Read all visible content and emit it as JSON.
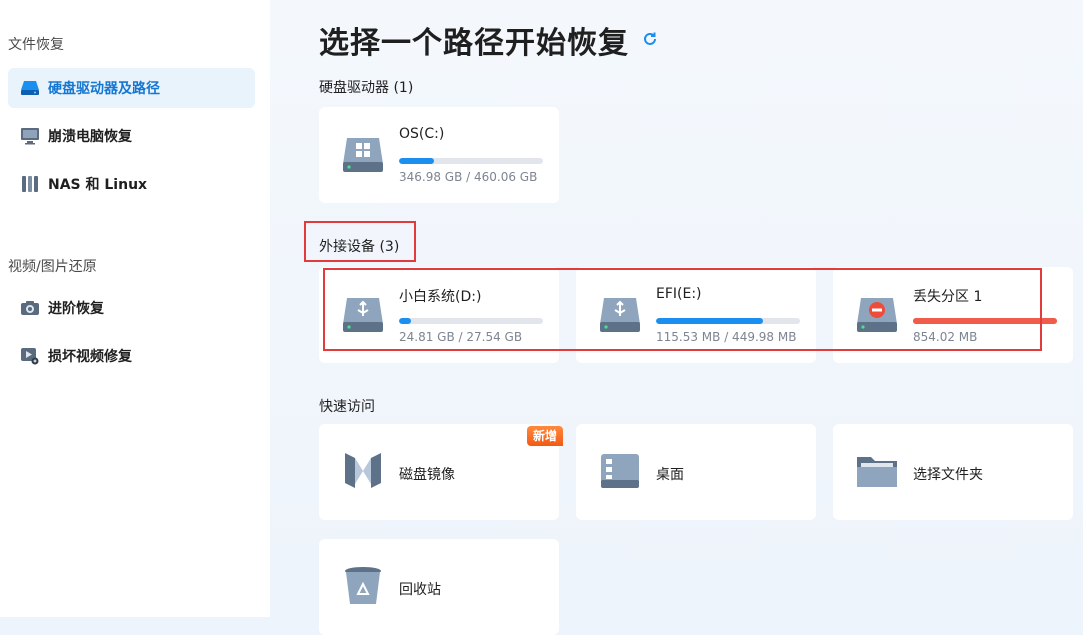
{
  "sidebar": {
    "sections": [
      {
        "title": "文件恢复",
        "items": [
          {
            "label": "硬盘驱动器及路径",
            "icon": "hard-drive-icon",
            "active": true
          },
          {
            "label": "崩溃电脑恢复",
            "icon": "monitor-icon",
            "active": false
          },
          {
            "label": "NAS 和 Linux",
            "icon": "nas-icon",
            "active": false
          }
        ]
      },
      {
        "title": "视频/图片还原",
        "items": [
          {
            "label": "进阶恢复",
            "icon": "camera-icon",
            "active": false
          },
          {
            "label": "损坏视频修复",
            "icon": "video-repair-icon",
            "active": false
          }
        ]
      }
    ]
  },
  "main": {
    "title": "选择一个路径开始恢复",
    "hard_drives": {
      "label": "硬盘驱动器 (1)",
      "drives": [
        {
          "name": "OS(C:)",
          "size": "346.98 GB / 460.06 GB",
          "usage": 0.24,
          "icon": "windows-drive-icon"
        }
      ]
    },
    "external": {
      "label": "外接设备 (3)",
      "drives": [
        {
          "name": "小白系统(D:)",
          "size": "24.81 GB / 27.54 GB",
          "usage": 0.08,
          "icon": "usb-drive-icon"
        },
        {
          "name": "EFI(E:)",
          "size": "115.53 MB / 449.98 MB",
          "usage": 0.74,
          "icon": "usb-drive-icon"
        },
        {
          "name": "丢失分区 1",
          "size": "854.02 MB",
          "usage": 1.0,
          "icon": "lost-partition-icon"
        }
      ]
    },
    "quick_access": {
      "label": "快速访问",
      "items": [
        {
          "name": "磁盘镜像",
          "icon": "disk-image-icon",
          "badge": "新增"
        },
        {
          "name": "桌面",
          "icon": "desktop-icon"
        },
        {
          "name": "选择文件夹",
          "icon": "folder-icon"
        },
        {
          "name": "回收站",
          "icon": "recycle-bin-icon"
        }
      ]
    }
  },
  "colors": {
    "accent": "#1677d2",
    "bar_blue": "#1b8ff0",
    "bar_red": "#f05b4b",
    "highlight_red": "#e23b3b"
  }
}
